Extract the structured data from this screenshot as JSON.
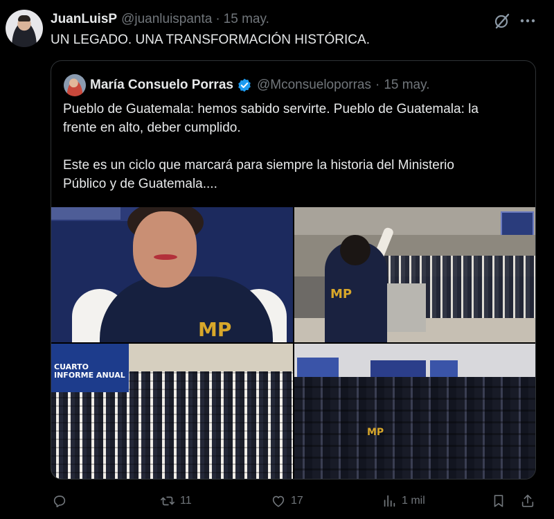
{
  "tweet": {
    "author_name": "JuanLuisP",
    "author_handle": "@juanluispanta",
    "separator": "·",
    "date": "15 may.",
    "text": "UN LEGADO. UNA TRANSFORMACIÓN HISTÓRICA."
  },
  "quoted": {
    "author_name": "María Consuelo Porras",
    "verified": true,
    "author_handle": "@Mconsueloporras",
    "separator": "·",
    "date": "15 may.",
    "text_lines": [
      "Pueblo de Guatemala: hemos sabido servirte. Pueblo de Guatemala: la",
      "frente en alto, deber cumplido.",
      "",
      "Este es un ciclo que marcará para siempre la historia del Ministerio",
      "Público y de Guatemala...."
    ],
    "photos": {
      "p1_logo": "MP",
      "p2_logo": "MP",
      "p3_screen_title": "CUARTO INFORME ANUAL",
      "p4_logo": "MP"
    }
  },
  "actions": {
    "reply_count": "",
    "retweet_count": "11",
    "like_count": "17",
    "views_count": "1 mil"
  },
  "icons": {
    "grok": "grok-icon",
    "more": "more-icon",
    "verified": "verified-badge-icon",
    "reply": "reply-icon",
    "retweet": "retweet-icon",
    "like": "heart-icon",
    "views": "views-icon",
    "bookmark": "bookmark-icon",
    "share": "share-icon"
  },
  "colors": {
    "background": "#000000",
    "text_primary": "#e7e9ea",
    "text_secondary": "#71767b",
    "border": "#2f3336",
    "verified": "#1d9bf0",
    "mp_gold": "#d8a72a"
  }
}
